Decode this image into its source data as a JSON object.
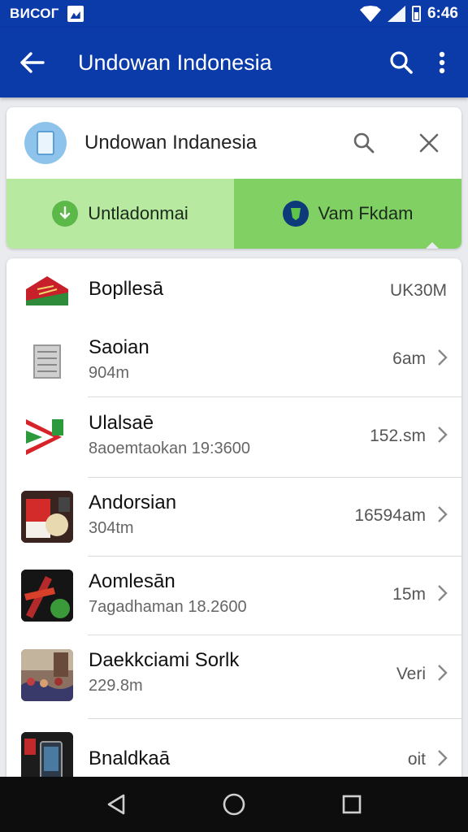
{
  "status_bar": {
    "carrier": "ВИСОГ",
    "time": "6:46"
  },
  "app_bar": {
    "title": "Undowan Indonesia",
    "icons": [
      "back-arrow-icon",
      "search-icon",
      "more-vert-icon"
    ]
  },
  "search": {
    "query": "Undowan Indanesia"
  },
  "tabs": [
    {
      "label": "Untladonmai",
      "icon": "download-icon",
      "selected": false
    },
    {
      "label": "Vam Fkdam",
      "icon": "shield-icon",
      "selected": true
    }
  ],
  "list": {
    "items": [
      {
        "name": "Bopllesā",
        "sub": "",
        "meta": "UK30M",
        "chevron": false
      },
      {
        "name": "Saoian",
        "sub": "904m",
        "meta": "6am",
        "chevron": true
      },
      {
        "name": "Ulalsaē",
        "sub": "8aoemtaokan 19:3600",
        "meta": "152.sm",
        "chevron": true
      },
      {
        "name": "Andorsian",
        "sub": "304tm",
        "meta": "16594am",
        "chevron": true
      },
      {
        "name": "Aomlesān",
        "sub": "7agadhaman 18.2600",
        "meta": "15m",
        "chevron": true
      },
      {
        "name": "Daekkciami Sorlk",
        "sub": "229.8m",
        "meta": "Veri",
        "chevron": true
      },
      {
        "name": "Bnaldkaā",
        "sub": "",
        "meta": "oit",
        "chevron": true
      }
    ]
  },
  "colors": {
    "primary": "#0b3aa9",
    "tab_light": "#b8e9a0",
    "tab_selected": "#80d064"
  }
}
